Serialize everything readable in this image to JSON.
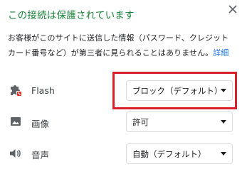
{
  "title": "この接続は保護されています",
  "description": {
    "text": "お客様がこのサイトに送信した情報（パスワード、クレジット カード番号など）が第三者に見られることはありません。",
    "link": "詳細"
  },
  "permissions": [
    {
      "label": "Flash",
      "icon": "puzzle-blocked-icon",
      "value": "ブロック（デフォルト）"
    },
    {
      "label": "画像",
      "icon": "image-icon",
      "value": "許可"
    },
    {
      "label": "音声",
      "icon": "speaker-icon",
      "value": "自動（デフォルト）"
    }
  ],
  "colors": {
    "title_green": "#188038",
    "link_blue": "#1a73e8",
    "highlight_red": "#d9202a"
  }
}
